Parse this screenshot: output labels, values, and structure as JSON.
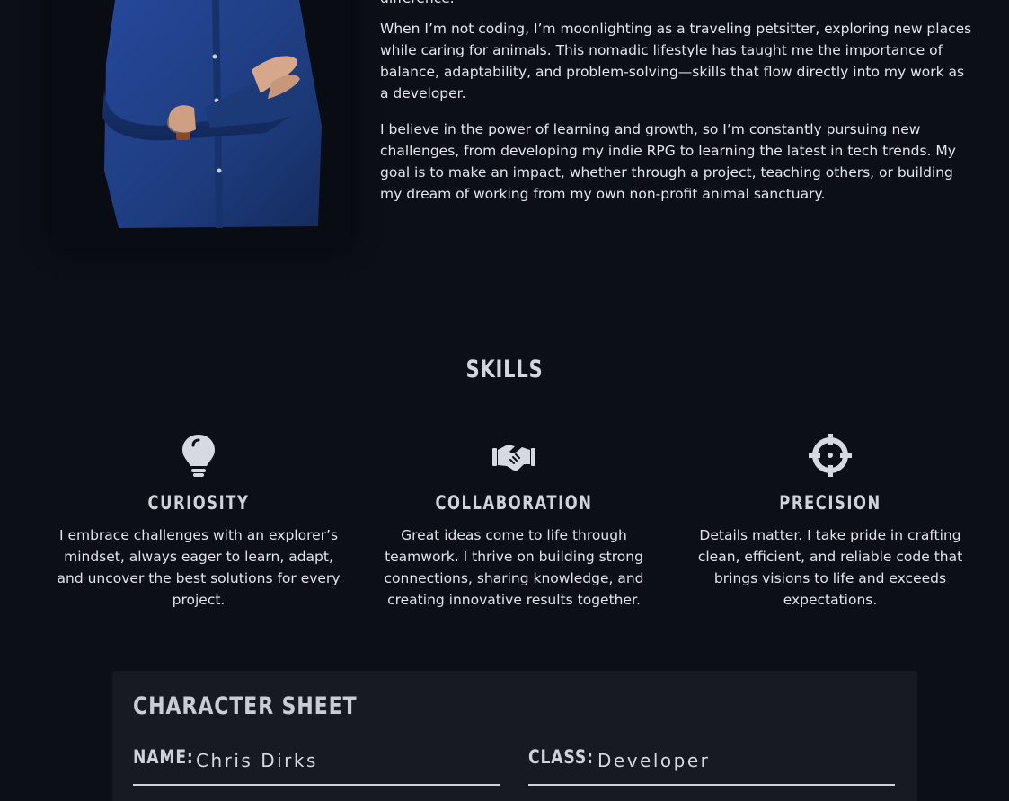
{
  "about": {
    "fragment": "difference.",
    "paragraphs": [
      "When I’m not coding, I’m moonlighting as a traveling petsitter, exploring new places while caring for animals. This nomadic lifestyle has taught me the importance of balance, adaptability, and problem-solving—skills that flow directly into my work as a developer.",
      "I believe in the power of learning and growth, so I’m constantly pursuing new challenges, from developing my indie RPG to learning the latest in tech trends. My goal is to make an impact, whether through a project, teaching others, or building my dream of working from my own non-profit animal sanctuary."
    ]
  },
  "skills": {
    "title": "SKILLS",
    "items": [
      {
        "icon": "lightbulb-icon",
        "name": "CURIOSITY",
        "description": "I embrace challenges with an explorer’s mindset, always eager to learn, adapt, and uncover the best solutions for every project."
      },
      {
        "icon": "handshake-icon",
        "name": "COLLABORATION",
        "description": "Great ideas come to life through teamwork. I thrive on building strong connections, sharing knowledge, and creating innovative results together."
      },
      {
        "icon": "crosshairs-icon",
        "name": "PRECISION",
        "description": "Details matter. I take pride in crafting clean, efficient, and reliable code that brings visions to life and exceeds expectations."
      }
    ]
  },
  "character_sheet": {
    "title": "CHARACTER SHEET",
    "name_label": "NAME:",
    "name_value": "Chris Dirks",
    "class_label": "CLASS:",
    "class_value": "Developer"
  },
  "colors": {
    "background": "#0c0f18",
    "card": "#171a23",
    "heading": "#d3d6df",
    "text": "#e4e6ec",
    "shirt": "#1f3f7c"
  }
}
